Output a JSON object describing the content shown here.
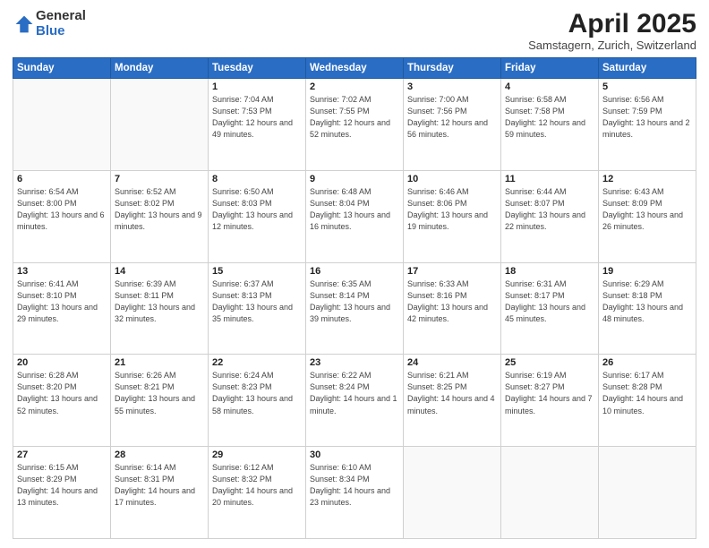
{
  "header": {
    "logo_general": "General",
    "logo_blue": "Blue",
    "month_title": "April 2025",
    "subtitle": "Samstagern, Zurich, Switzerland"
  },
  "days_of_week": [
    "Sunday",
    "Monday",
    "Tuesday",
    "Wednesday",
    "Thursday",
    "Friday",
    "Saturday"
  ],
  "weeks": [
    [
      {
        "day": "",
        "info": ""
      },
      {
        "day": "",
        "info": ""
      },
      {
        "day": "1",
        "info": "Sunrise: 7:04 AM\nSunset: 7:53 PM\nDaylight: 12 hours and 49 minutes."
      },
      {
        "day": "2",
        "info": "Sunrise: 7:02 AM\nSunset: 7:55 PM\nDaylight: 12 hours and 52 minutes."
      },
      {
        "day": "3",
        "info": "Sunrise: 7:00 AM\nSunset: 7:56 PM\nDaylight: 12 hours and 56 minutes."
      },
      {
        "day": "4",
        "info": "Sunrise: 6:58 AM\nSunset: 7:58 PM\nDaylight: 12 hours and 59 minutes."
      },
      {
        "day": "5",
        "info": "Sunrise: 6:56 AM\nSunset: 7:59 PM\nDaylight: 13 hours and 2 minutes."
      }
    ],
    [
      {
        "day": "6",
        "info": "Sunrise: 6:54 AM\nSunset: 8:00 PM\nDaylight: 13 hours and 6 minutes."
      },
      {
        "day": "7",
        "info": "Sunrise: 6:52 AM\nSunset: 8:02 PM\nDaylight: 13 hours and 9 minutes."
      },
      {
        "day": "8",
        "info": "Sunrise: 6:50 AM\nSunset: 8:03 PM\nDaylight: 13 hours and 12 minutes."
      },
      {
        "day": "9",
        "info": "Sunrise: 6:48 AM\nSunset: 8:04 PM\nDaylight: 13 hours and 16 minutes."
      },
      {
        "day": "10",
        "info": "Sunrise: 6:46 AM\nSunset: 8:06 PM\nDaylight: 13 hours and 19 minutes."
      },
      {
        "day": "11",
        "info": "Sunrise: 6:44 AM\nSunset: 8:07 PM\nDaylight: 13 hours and 22 minutes."
      },
      {
        "day": "12",
        "info": "Sunrise: 6:43 AM\nSunset: 8:09 PM\nDaylight: 13 hours and 26 minutes."
      }
    ],
    [
      {
        "day": "13",
        "info": "Sunrise: 6:41 AM\nSunset: 8:10 PM\nDaylight: 13 hours and 29 minutes."
      },
      {
        "day": "14",
        "info": "Sunrise: 6:39 AM\nSunset: 8:11 PM\nDaylight: 13 hours and 32 minutes."
      },
      {
        "day": "15",
        "info": "Sunrise: 6:37 AM\nSunset: 8:13 PM\nDaylight: 13 hours and 35 minutes."
      },
      {
        "day": "16",
        "info": "Sunrise: 6:35 AM\nSunset: 8:14 PM\nDaylight: 13 hours and 39 minutes."
      },
      {
        "day": "17",
        "info": "Sunrise: 6:33 AM\nSunset: 8:16 PM\nDaylight: 13 hours and 42 minutes."
      },
      {
        "day": "18",
        "info": "Sunrise: 6:31 AM\nSunset: 8:17 PM\nDaylight: 13 hours and 45 minutes."
      },
      {
        "day": "19",
        "info": "Sunrise: 6:29 AM\nSunset: 8:18 PM\nDaylight: 13 hours and 48 minutes."
      }
    ],
    [
      {
        "day": "20",
        "info": "Sunrise: 6:28 AM\nSunset: 8:20 PM\nDaylight: 13 hours and 52 minutes."
      },
      {
        "day": "21",
        "info": "Sunrise: 6:26 AM\nSunset: 8:21 PM\nDaylight: 13 hours and 55 minutes."
      },
      {
        "day": "22",
        "info": "Sunrise: 6:24 AM\nSunset: 8:23 PM\nDaylight: 13 hours and 58 minutes."
      },
      {
        "day": "23",
        "info": "Sunrise: 6:22 AM\nSunset: 8:24 PM\nDaylight: 14 hours and 1 minute."
      },
      {
        "day": "24",
        "info": "Sunrise: 6:21 AM\nSunset: 8:25 PM\nDaylight: 14 hours and 4 minutes."
      },
      {
        "day": "25",
        "info": "Sunrise: 6:19 AM\nSunset: 8:27 PM\nDaylight: 14 hours and 7 minutes."
      },
      {
        "day": "26",
        "info": "Sunrise: 6:17 AM\nSunset: 8:28 PM\nDaylight: 14 hours and 10 minutes."
      }
    ],
    [
      {
        "day": "27",
        "info": "Sunrise: 6:15 AM\nSunset: 8:29 PM\nDaylight: 14 hours and 13 minutes."
      },
      {
        "day": "28",
        "info": "Sunrise: 6:14 AM\nSunset: 8:31 PM\nDaylight: 14 hours and 17 minutes."
      },
      {
        "day": "29",
        "info": "Sunrise: 6:12 AM\nSunset: 8:32 PM\nDaylight: 14 hours and 20 minutes."
      },
      {
        "day": "30",
        "info": "Sunrise: 6:10 AM\nSunset: 8:34 PM\nDaylight: 14 hours and 23 minutes."
      },
      {
        "day": "",
        "info": ""
      },
      {
        "day": "",
        "info": ""
      },
      {
        "day": "",
        "info": ""
      }
    ]
  ]
}
